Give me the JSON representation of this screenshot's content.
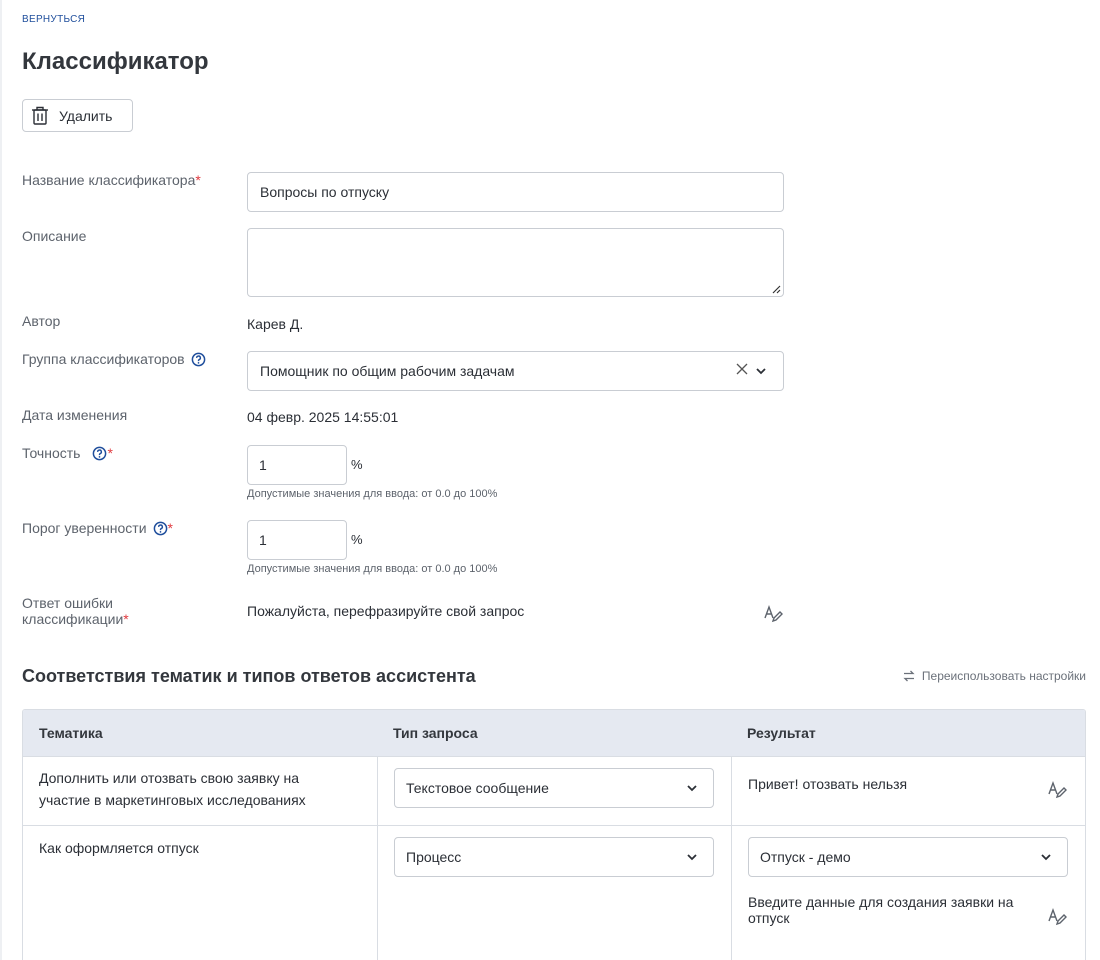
{
  "nav": {
    "back_label": "ВЕРНУТЬСЯ"
  },
  "page": {
    "title": "Классификатор"
  },
  "toolbar": {
    "delete_label": "Удалить",
    "delete_icon": "trash-icon"
  },
  "form": {
    "name": {
      "label": "Название классификатора",
      "value": "Вопросы по отпуску"
    },
    "description": {
      "label": "Описание",
      "value": ""
    },
    "author": {
      "label": "Автор",
      "value": "Карев Д."
    },
    "group": {
      "label": "Группа классификаторов",
      "value": "Помощник по общим рабочим задачам"
    },
    "modified": {
      "label": "Дата изменения",
      "value": "04 февр. 2025 14:55:01"
    },
    "accuracy": {
      "label": "Точность",
      "value": "1",
      "unit": "%",
      "hint": "Допустимые значения для ввода: от 0.0 до 100%"
    },
    "threshold": {
      "label": "Порог уверенности",
      "value": "1",
      "unit": "%",
      "hint": "Допустимые значения для ввода: от 0.0 до 100%"
    },
    "error_answer": {
      "label_line1": "Ответ ошибки",
      "label_line2": "классификации",
      "value": "Пожалуйста, перефразируйте свой запрос"
    }
  },
  "mapping": {
    "title": "Соответствия тематик и типов ответов ассистента",
    "reuse_label": "Переиспользовать настройки",
    "columns": [
      "Тематика",
      "Тип запроса",
      "Результат"
    ],
    "rows": [
      {
        "topic_line1": "Дополнить или отозвать свою заявку на",
        "topic_line2": "участие в маркетинговых исследованиях",
        "request_type": "Текстовое сообщение",
        "result_text": "Привет! отозвать нельзя"
      },
      {
        "topic_line1": "Как оформляется отпуск",
        "request_type": "Процесс",
        "result_select": "Отпуск - демо",
        "result_text_line1": "Введите данные для создания заявки на",
        "result_text_line2": "отпуск"
      }
    ]
  },
  "colors": {
    "accent": "#1f4e9c",
    "required": "#e0393e",
    "header_bg": "#e5e9f1",
    "border": "#c9cdd3"
  }
}
